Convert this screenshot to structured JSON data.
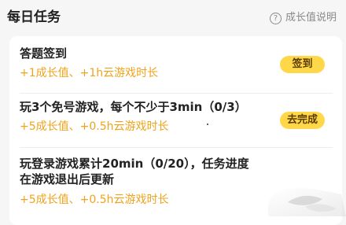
{
  "header": {
    "title": "每日任务",
    "help_label": "成长值说明",
    "help_icon": "?"
  },
  "tasks": [
    {
      "name": "答题签到",
      "reward": "+1成长值、+1h云游戏时长",
      "button": "签到"
    },
    {
      "name": "玩3个免号游戏，每个不少于3min（0/3）",
      "reward": "+5成长值、+0.5h云游戏时长",
      "button": "去完成"
    },
    {
      "name_line1": "玩登录游戏累计20min（0/20），任务进度",
      "name_line2": "在游戏退出后更新",
      "reward": "+5成长值、+0.5h云游戏时长"
    }
  ],
  "colors": {
    "reward": "#f0a31a",
    "button_bg": "#ffd84a",
    "page_bg": "#f6f6f6"
  },
  "watermark_icon": "logo-watermark"
}
